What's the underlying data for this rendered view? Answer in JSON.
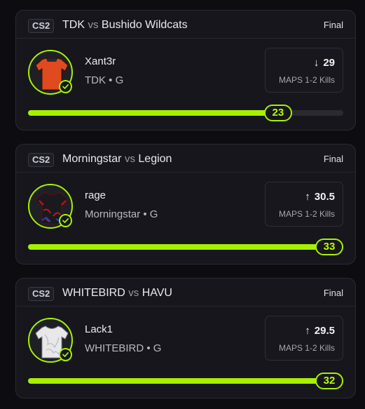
{
  "colors": {
    "accent": "#a6f000",
    "background": "#0d0d11",
    "card": "#16161c"
  },
  "cards": [
    {
      "game": "CS2",
      "team_a": "TDK",
      "vs": "vs",
      "team_b": "Bushido Wildcats",
      "status": "Final",
      "player": "Xant3r",
      "team_pos": "TDK • G",
      "direction_icon": "arrow-down-icon",
      "direction_glyph": "↓",
      "line": "29",
      "stat_label": "MAPS 1-2 Kills",
      "result": "23",
      "progress_fraction": 0.793,
      "jersey_color": "#e04a1f"
    },
    {
      "game": "CS2",
      "team_a": "Morningstar",
      "vs": "vs",
      "team_b": "Legion",
      "status": "Final",
      "player": "rage",
      "team_pos": "Morningstar • G",
      "direction_icon": "arrow-up-icon",
      "direction_glyph": "↑",
      "line": "30.5",
      "stat_label": "MAPS 1-2 Kills",
      "result": "33",
      "progress_fraction": 1.0,
      "jersey_color": "#1a1a1e"
    },
    {
      "game": "CS2",
      "team_a": "WHITEBIRD",
      "vs": "vs",
      "team_b": "HAVU",
      "status": "Final",
      "player": "Lack1",
      "team_pos": "WHITEBIRD • G",
      "direction_icon": "arrow-up-icon",
      "direction_glyph": "↑",
      "line": "29.5",
      "stat_label": "MAPS 1-2 Kills",
      "result": "32",
      "progress_fraction": 1.0,
      "jersey_color": "#e8e8ea"
    }
  ]
}
